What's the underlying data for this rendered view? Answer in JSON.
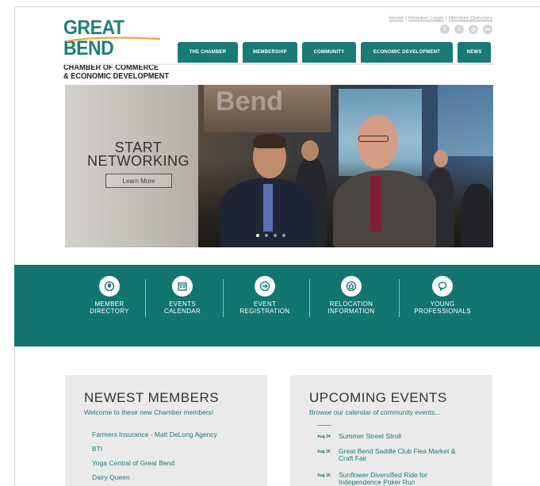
{
  "header": {
    "logo_title": "GREAT BEND",
    "logo_line1": "CHAMBER OF COMMERCE",
    "logo_line2": "& ECONOMIC DEVELOPMENT",
    "util_links": [
      "Home",
      "Member Login",
      "Member Directory"
    ],
    "util_sep": " | ",
    "social_icons": [
      "facebook-icon",
      "twitter-icon",
      "instagram-icon",
      "linkedin-icon"
    ]
  },
  "nav": {
    "tabs": [
      {
        "label": "THE CHAMBER"
      },
      {
        "label": "MEMBERSHIP"
      },
      {
        "label": "COMMUNITY"
      },
      {
        "label": "ECONOMIC DEVELOPMENT"
      },
      {
        "label": "NEWS"
      }
    ]
  },
  "hero": {
    "title_line1": "START",
    "title_line2": "NETWORKING",
    "button_label": "Learn More",
    "sign_text": "Bend",
    "slide_count": 4,
    "active_slide": 1
  },
  "quick_links": [
    {
      "line1": "MEMBER",
      "line2": "DIRECTORY",
      "icon": "location-pin-icon"
    },
    {
      "line1": "EVENTS",
      "line2": "CALENDAR",
      "icon": "calendar-icon"
    },
    {
      "line1": "EVENT",
      "line2": "REGISTRATION",
      "icon": "arrow-right-icon"
    },
    {
      "line1": "RELOCATION",
      "line2": "INFORMATION",
      "icon": "home-icon"
    },
    {
      "line1": "YOUNG",
      "line2": "PROFESSIONALS",
      "icon": "chat-bubble-icon"
    }
  ],
  "newest_members": {
    "title": "NEWEST MEMBERS",
    "subtitle": "Welcome to these new Chamber members!",
    "items": [
      "Farmers Insurance - Matt DeLong Agency",
      "BTI",
      "Yoga Central of Great Bend",
      "Dairy Queen"
    ]
  },
  "upcoming_events": {
    "title": "UPCOMING EVENTS",
    "subtitle": "Browse our calendar of community events...",
    "items": [
      {
        "date": "Aug 24",
        "title": "Summer Street Stroll"
      },
      {
        "date": "Aug 26",
        "title": "Great Bend Saddle Club Flea Market & Craft Fair"
      },
      {
        "date": "Aug 26",
        "title": "Sunflower Diversified Ride for Independence Poker Run"
      }
    ]
  },
  "colors": {
    "teal": "#1a7a78",
    "band": "#137570",
    "box_bg": "#eaeaea"
  }
}
